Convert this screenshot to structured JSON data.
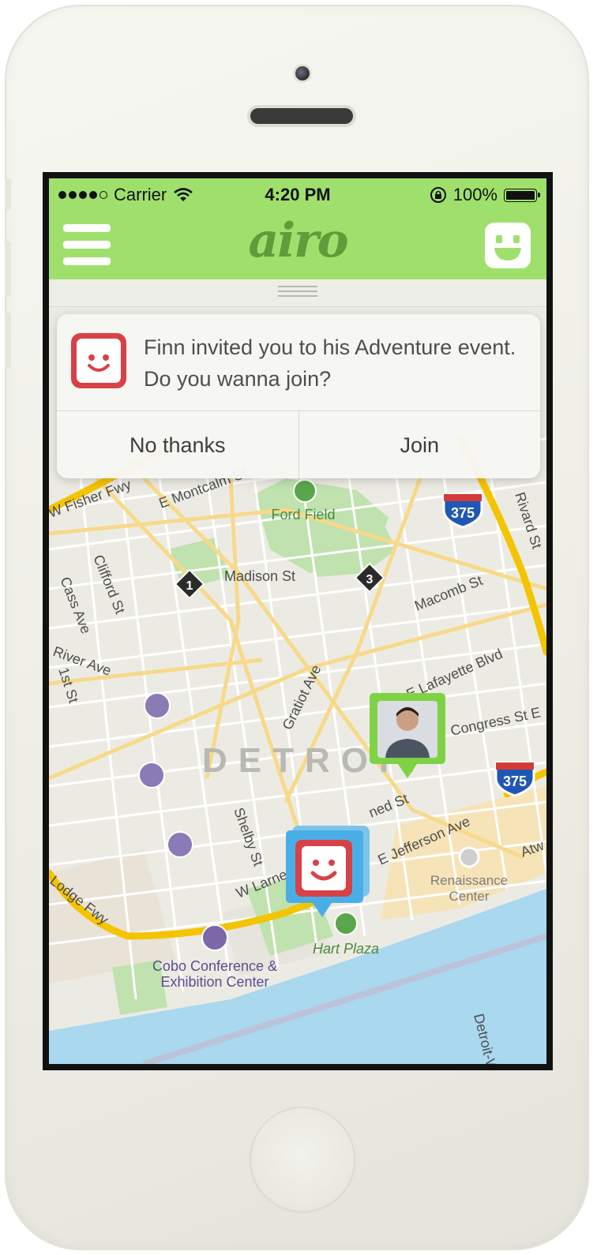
{
  "status_bar": {
    "carrier": "Carrier",
    "time": "4:20 PM",
    "battery": "100%"
  },
  "header": {
    "logo": "airo"
  },
  "notification": {
    "message": "Finn invited you to his Adventure event. Do you wanna join?",
    "decline_label": "No thanks",
    "join_label": "Join"
  },
  "map": {
    "city_label": "DETROIT",
    "places": {
      "ford_field": "Ford Field",
      "renaissance": "Renaissance\nCenter",
      "hart_plaza": "Hart Plaza",
      "cobo": "Cobo Conference &\nExhibition Center"
    },
    "streets": {
      "madison": "Madison St",
      "macomb": "Macomb St",
      "lafayette": "E Lafayette Blvd",
      "congress": "Congress St E",
      "jefferson": "E Jefferson Ave",
      "gratiot": "Gratiot Ave",
      "clifford": "Clifford St",
      "cass": "Cass Ave",
      "river": "River Ave",
      "first": "1st St",
      "shelby": "Shelby St",
      "fisher": "W Fisher Fwy",
      "rivard": "Rivard St",
      "larned": "W Larned St",
      "e_montcalm": "E Montcalm St",
      "lodge": "Lodge Fwy",
      "detroit_w": "Detroit-Windsor Tunnel",
      "ned": "ned St",
      "atw": "Atw"
    },
    "shields": {
      "i375": "375",
      "m1": "1",
      "m3": "3"
    }
  },
  "colors": {
    "header_green": "#9fe06d",
    "logo_green": "#5f9c3a",
    "brand_red": "#d74247",
    "pin_blue": "#4aaee6",
    "pin_green": "#7fd245",
    "water": "#a9d8ef"
  },
  "icons": {
    "menu": "hamburger-icon",
    "face": "smiley-face-icon",
    "wifi": "wifi-icon",
    "lock": "rotation-lock-icon"
  }
}
